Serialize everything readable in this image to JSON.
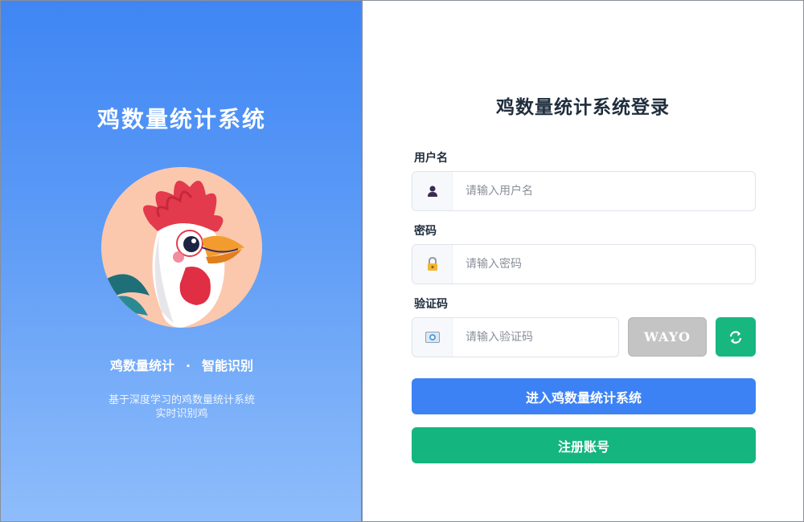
{
  "brand": {
    "title": "鸡数量统计系统",
    "tagline_left": "鸡数量统计",
    "tagline_sep": "·",
    "tagline_right": "智能识别",
    "desc_line1": "基于深度学习的鸡数量统计系统",
    "desc_line2": "实时识别鸡"
  },
  "form": {
    "title": "鸡数量统计系统登录",
    "username": {
      "label": "用户名",
      "placeholder": "请输入用户名",
      "value": "",
      "icon": "user-icon"
    },
    "password": {
      "label": "密码",
      "placeholder": "请输入密码",
      "value": "",
      "icon": "lock-icon"
    },
    "captcha": {
      "label": "验证码",
      "placeholder": "请输入验证码",
      "value": "",
      "icon": "captcha-card-icon",
      "code": "WAYO",
      "refresh_icon": "refresh-icon"
    },
    "login_button": "进入鸡数量统计系统",
    "register_button": "注册账号"
  },
  "colors": {
    "gradient_top": "#3f86f4",
    "gradient_bottom": "#8fbdfb",
    "primary": "#3c82f5",
    "success": "#14b57f",
    "captcha_bg": "#c4c4c4"
  }
}
